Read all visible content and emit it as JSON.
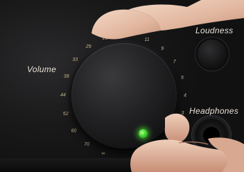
{
  "panel": {
    "volume_label": "Volume",
    "loudness_label": "Loudness",
    "headphones_label": "Headphones"
  },
  "dial_scale": {
    "left_marks": [
      "25",
      "29",
      "33",
      "38",
      "44",
      "52",
      "60",
      "70",
      "∞"
    ],
    "right_marks": [
      "11",
      "9",
      "7",
      "5",
      "4",
      "3",
      "2",
      "dB"
    ],
    "mark_color": "#c9b98f"
  },
  "indicator": {
    "color": "#41d42e"
  }
}
